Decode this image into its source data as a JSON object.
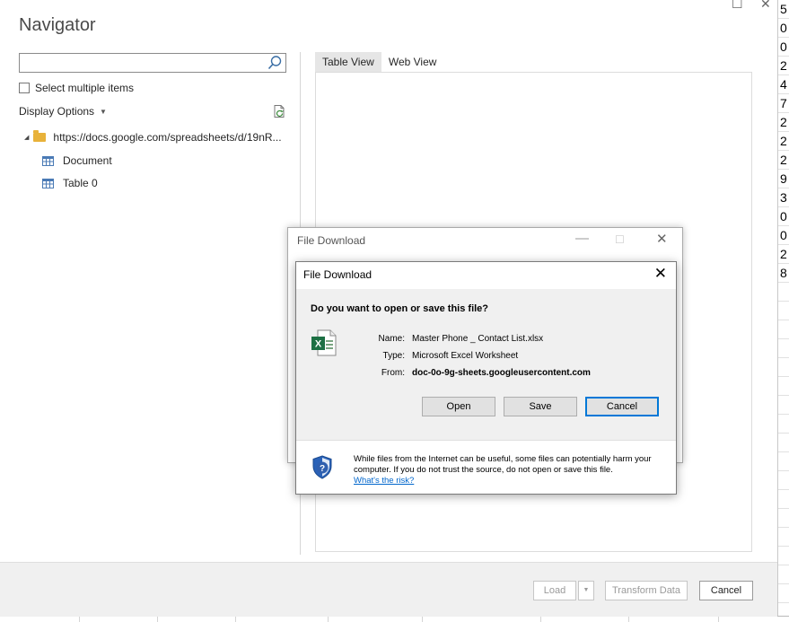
{
  "sheet": {
    "visible_digits": [
      "5",
      "0",
      "0",
      "2",
      "4",
      "7",
      "2",
      "2",
      "2",
      "9",
      "3",
      "0",
      "0",
      "2",
      "8"
    ]
  },
  "navigator": {
    "title": "Navigator",
    "window_controls": {
      "maximize": "☐",
      "close": "✕"
    },
    "search": {
      "value": "",
      "placeholder": ""
    },
    "select_multiple_label": "Select multiple items",
    "display_options_label": "Display Options",
    "tree": {
      "root_label": "https://docs.google.com/spreadsheets/d/19nR...",
      "items": [
        {
          "label": "Document",
          "icon": "table-icon"
        },
        {
          "label": "Table 0",
          "icon": "table-icon"
        }
      ]
    },
    "tabs": [
      {
        "label": "Table View",
        "active": true
      },
      {
        "label": "Web View",
        "active": false
      }
    ],
    "footer": {
      "load_label": "Load",
      "load_dropdown": "▼",
      "transform_label": "Transform Data",
      "cancel_label": "Cancel"
    }
  },
  "outer_dialog": {
    "title": "File Download",
    "controls": {
      "minimize": "—",
      "maximize": "☐",
      "close": "✕"
    }
  },
  "download_dialog": {
    "title": "File Download",
    "close": "✕",
    "question": "Do you want to open or save this file?",
    "file": {
      "name_label": "Name:",
      "name": "Master Phone _ Contact List.xlsx",
      "type_label": "Type:",
      "type": "Microsoft Excel Worksheet",
      "from_label": "From:",
      "from": "doc-0o-9g-sheets.googleusercontent.com"
    },
    "buttons": {
      "open": "Open",
      "save": "Save",
      "cancel": "Cancel"
    },
    "warning": {
      "text": "While files from the Internet can be useful, some files can potentially harm your computer. If you do not trust the source, do not open or save this file.",
      "link": "What's the risk?"
    },
    "colors": {
      "link": "#0066cc",
      "excel_green": "#1d7044",
      "default_button_border": "#0078d7"
    }
  }
}
